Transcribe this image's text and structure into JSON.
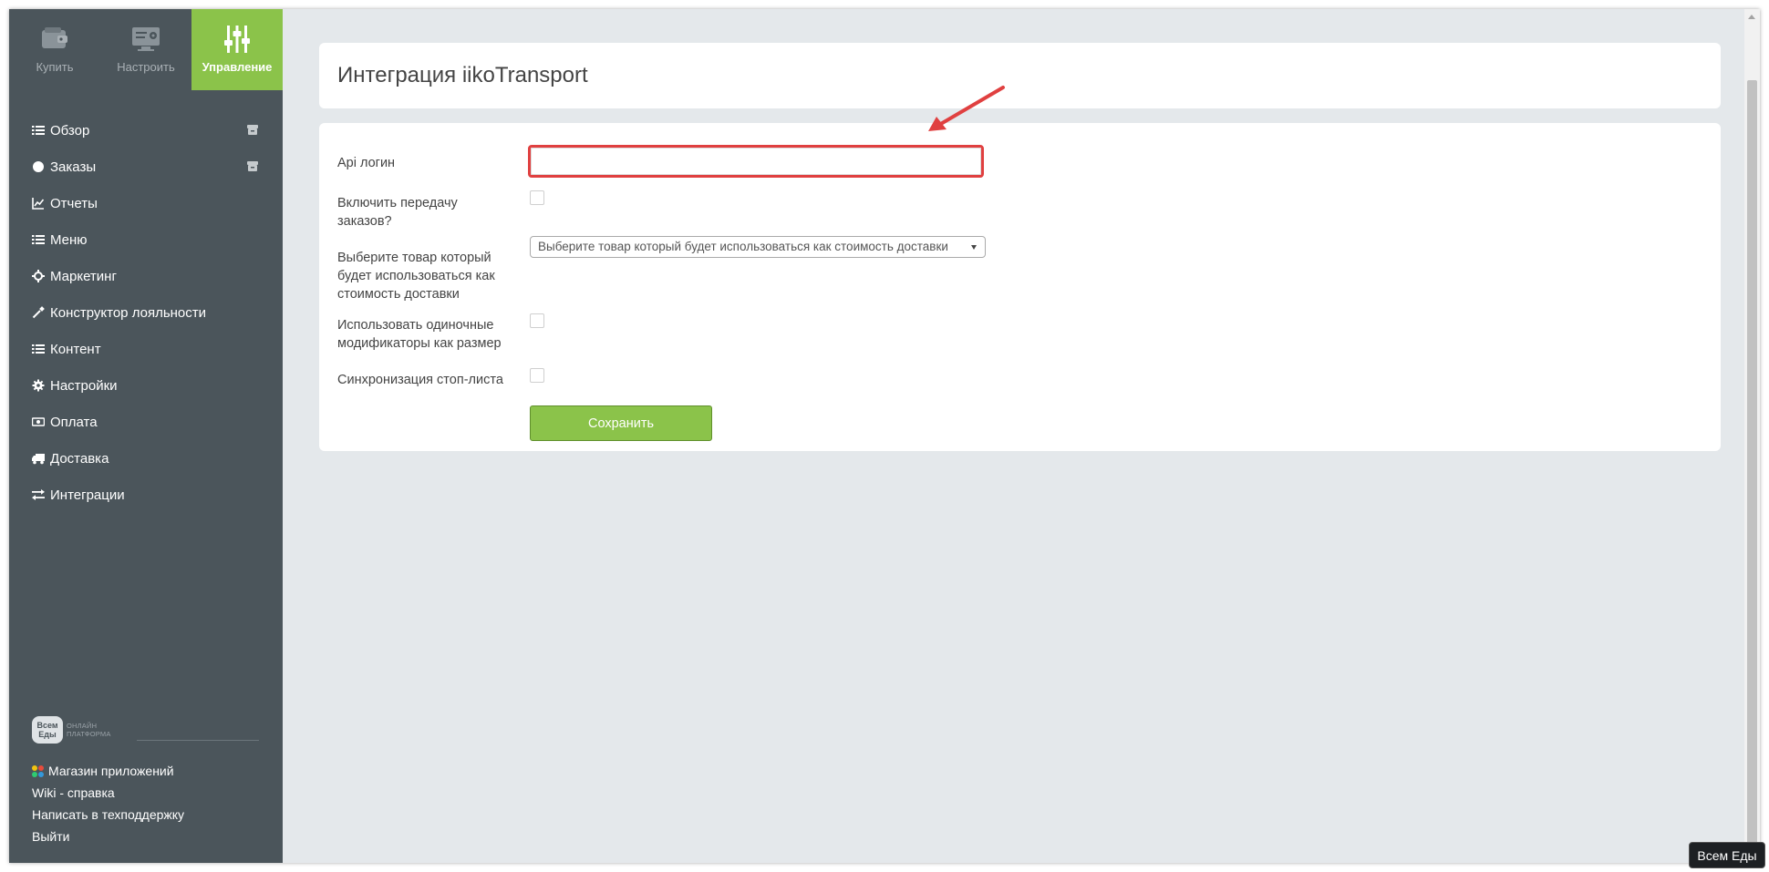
{
  "colors": {
    "accent": "#8bc34a",
    "sidebar": "#4b555b",
    "annotation": "#e04040"
  },
  "top_tabs": [
    {
      "label": "Купить",
      "icon": "wallet-icon"
    },
    {
      "label": "Настроить",
      "icon": "settings-monitor-icon"
    },
    {
      "label": "Управление",
      "icon": "sliders-icon",
      "active": true
    }
  ],
  "nav": [
    {
      "label": "Обзор",
      "icon": "list-icon",
      "side_icon": "archive-icon"
    },
    {
      "label": "Заказы",
      "icon": "circle-icon",
      "side_icon": "archive-icon"
    },
    {
      "label": "Отчеты",
      "icon": "line-chart-icon"
    },
    {
      "label": "Меню",
      "icon": "list-icon"
    },
    {
      "label": "Маркетинг",
      "icon": "crosshair-icon"
    },
    {
      "label": "Конструктор лояльности",
      "icon": "magic-wand-icon"
    },
    {
      "label": "Контент",
      "icon": "list-icon"
    },
    {
      "label": "Настройки",
      "icon": "gear-icon"
    },
    {
      "label": "Оплата",
      "icon": "money-icon"
    },
    {
      "label": "Доставка",
      "icon": "truck-icon"
    },
    {
      "label": "Интеграции",
      "icon": "exchange-icon"
    }
  ],
  "brand": {
    "logo": "Всем Еды",
    "tagline_1": "ОНЛАЙН",
    "tagline_2": "ПЛАТФОРМА"
  },
  "footer_links": [
    {
      "label": "Магазин приложений",
      "icon": "apps-icon"
    },
    {
      "label": "Wiki - справка"
    },
    {
      "label": "Написать в техподдержку"
    },
    {
      "label": "Выйти"
    }
  ],
  "page": {
    "title": "Интеграция iikoTransport"
  },
  "form": {
    "api_login_label": "Api логин",
    "api_login_value": "",
    "enable_orders_label": "Включить передачу заказов?",
    "delivery_product_label": "Выберите товар который будет использоваться как стоимость доставки",
    "delivery_product_selected": "Выберите товар который будет использоваться как стоимость доставки",
    "single_modifiers_label": "Использовать одиночные модификаторы как размер",
    "stoplist_sync_label": "Синхронизация стоп-листа",
    "save_label": "Сохранить"
  },
  "badge": "Всем Еды"
}
